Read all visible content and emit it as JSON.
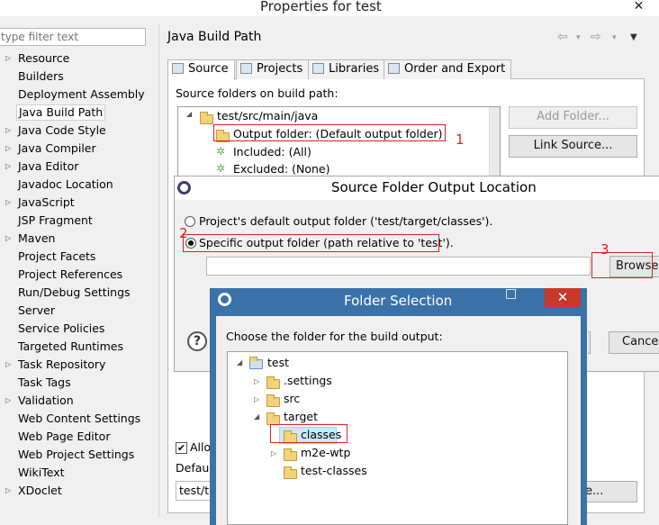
{
  "window": {
    "title": "Properties for test",
    "close_glyph": "✕"
  },
  "filter": {
    "placeholder": "type filter text"
  },
  "nav": {
    "items": [
      {
        "label": "Resource",
        "expandable": true
      },
      {
        "label": "Builders",
        "expandable": false
      },
      {
        "label": "Deployment Assembly",
        "expandable": false
      },
      {
        "label": "Java Build Path",
        "expandable": false,
        "selected": true
      },
      {
        "label": "Java Code Style",
        "expandable": true
      },
      {
        "label": "Java Compiler",
        "expandable": true
      },
      {
        "label": "Java Editor",
        "expandable": true
      },
      {
        "label": "Javadoc Location",
        "expandable": false
      },
      {
        "label": "JavaScript",
        "expandable": true
      },
      {
        "label": "JSP Fragment",
        "expandable": false
      },
      {
        "label": "Maven",
        "expandable": true
      },
      {
        "label": "Project Facets",
        "expandable": false
      },
      {
        "label": "Project References",
        "expandable": false
      },
      {
        "label": "Run/Debug Settings",
        "expandable": false
      },
      {
        "label": "Server",
        "expandable": false
      },
      {
        "label": "Service Policies",
        "expandable": false
      },
      {
        "label": "Targeted Runtimes",
        "expandable": false
      },
      {
        "label": "Task Repository",
        "expandable": true
      },
      {
        "label": "Task Tags",
        "expandable": false
      },
      {
        "label": "Validation",
        "expandable": true
      },
      {
        "label": "Web Content Settings",
        "expandable": false
      },
      {
        "label": "Web Page Editor",
        "expandable": false
      },
      {
        "label": "Web Project Settings",
        "expandable": false
      },
      {
        "label": "WikiText",
        "expandable": false
      },
      {
        "label": "XDoclet",
        "expandable": true
      }
    ]
  },
  "page": {
    "title": "Java Build Path",
    "tabs": [
      {
        "label": "Source"
      },
      {
        "label": "Projects"
      },
      {
        "label": "Libraries"
      },
      {
        "label": "Order and Export"
      }
    ],
    "source_label": "Source folders on build path:",
    "tree": {
      "root": "test/src/main/java",
      "output": "Output folder: (Default output folder)",
      "included": "Included: (All)",
      "excluded": "Excluded: (None)"
    },
    "buttons": {
      "add_folder": "Add Folder...",
      "link_source": "Link Source..."
    },
    "allow_label": "Allo",
    "default_label": "Defaul",
    "default_value": "test/ta",
    "browse_partial": "e...",
    "annotation_1": "1"
  },
  "output_dialog": {
    "title": "Source Folder Output Location",
    "option_default": "Project's default output folder ('test/target/classes').",
    "option_specific": "Specific output folder (path relative to 'test').",
    "path_value": "",
    "browse": "Browse...",
    "cancel": "Cancel",
    "help_glyph": "?",
    "annotation_2": "2",
    "annotation_3": "3"
  },
  "folder_dialog": {
    "title": "Folder Selection",
    "close_glyph": "✕",
    "prompt": "Choose the folder for the build output:",
    "tree": {
      "root": "test",
      "settings": ".settings",
      "src": "src",
      "target": "target",
      "classes": "classes",
      "m2e": "m2e-wtp",
      "test_classes": "test-classes"
    }
  },
  "colors": {
    "annotation_red": "#e02020",
    "folder_title_blue": "#3a72a9",
    "close_red": "#c7392a"
  }
}
